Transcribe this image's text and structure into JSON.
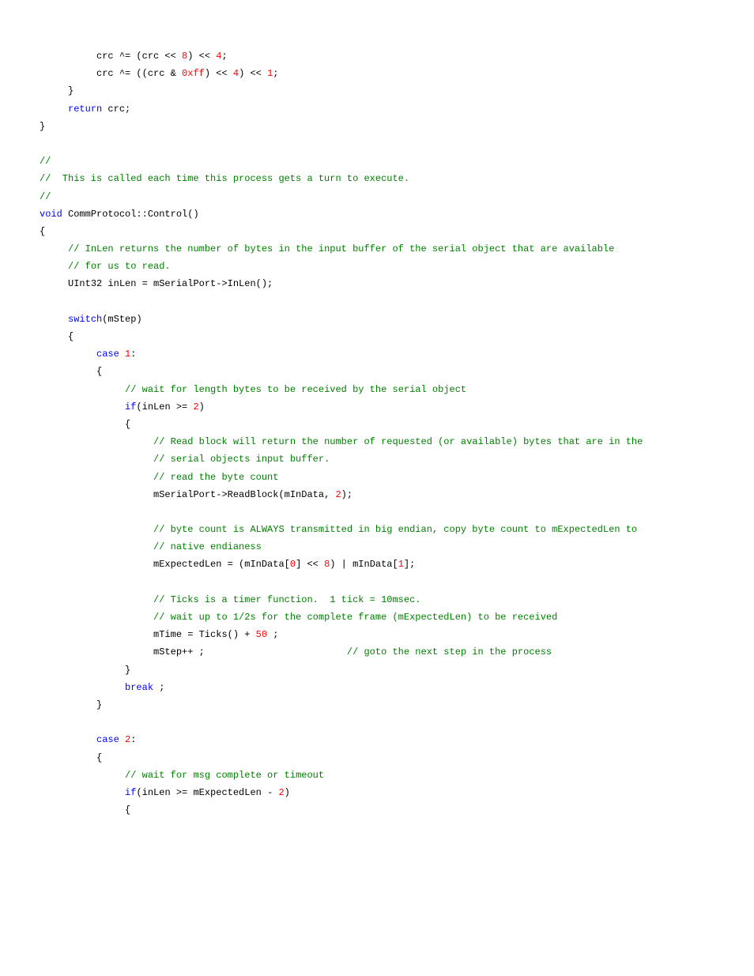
{
  "lines": [
    [
      {
        "t": "          crc ^= (crc << ",
        "c": ""
      },
      {
        "t": "8",
        "c": "num"
      },
      {
        "t": ") << ",
        "c": ""
      },
      {
        "t": "4",
        "c": "num"
      },
      {
        "t": ";",
        "c": ""
      }
    ],
    [
      {
        "t": "          crc ^= ((crc & ",
        "c": ""
      },
      {
        "t": "0xff",
        "c": "hex"
      },
      {
        "t": ") << ",
        "c": ""
      },
      {
        "t": "4",
        "c": "num"
      },
      {
        "t": ") << ",
        "c": ""
      },
      {
        "t": "1",
        "c": "num"
      },
      {
        "t": ";",
        "c": ""
      }
    ],
    [
      {
        "t": "     }",
        "c": ""
      }
    ],
    [
      {
        "t": "     ",
        "c": ""
      },
      {
        "t": "return",
        "c": "kw"
      },
      {
        "t": " crc;",
        "c": ""
      }
    ],
    [
      {
        "t": "}",
        "c": ""
      }
    ],
    [
      {
        "t": "",
        "c": ""
      }
    ],
    [
      {
        "t": "//",
        "c": "comment"
      }
    ],
    [
      {
        "t": "//  This is called each time this process gets a turn to execute.",
        "c": "comment"
      }
    ],
    [
      {
        "t": "//",
        "c": "comment"
      }
    ],
    [
      {
        "t": "void",
        "c": "kw"
      },
      {
        "t": " CommProtocol::Control()",
        "c": ""
      }
    ],
    [
      {
        "t": "{",
        "c": ""
      }
    ],
    [
      {
        "t": "     ",
        "c": ""
      },
      {
        "t": "// InLen returns the number of bytes in the input buffer of the serial object that are available",
        "c": "comment"
      }
    ],
    [
      {
        "t": "     ",
        "c": ""
      },
      {
        "t": "// for us to read.",
        "c": "comment"
      }
    ],
    [
      {
        "t": "     UInt32 inLen = mSerialPort->InLen();",
        "c": ""
      }
    ],
    [
      {
        "t": "",
        "c": ""
      }
    ],
    [
      {
        "t": "     ",
        "c": ""
      },
      {
        "t": "switch",
        "c": "kw"
      },
      {
        "t": "(mStep)",
        "c": ""
      }
    ],
    [
      {
        "t": "     {",
        "c": ""
      }
    ],
    [
      {
        "t": "          ",
        "c": ""
      },
      {
        "t": "case",
        "c": "kw"
      },
      {
        "t": " ",
        "c": ""
      },
      {
        "t": "1",
        "c": "num"
      },
      {
        "t": ":",
        "c": ""
      }
    ],
    [
      {
        "t": "          {",
        "c": ""
      }
    ],
    [
      {
        "t": "               ",
        "c": ""
      },
      {
        "t": "// wait for length bytes to be received by the serial object",
        "c": "comment"
      }
    ],
    [
      {
        "t": "               ",
        "c": ""
      },
      {
        "t": "if",
        "c": "kw"
      },
      {
        "t": "(inLen >= ",
        "c": ""
      },
      {
        "t": "2",
        "c": "num"
      },
      {
        "t": ")",
        "c": ""
      }
    ],
    [
      {
        "t": "               {",
        "c": ""
      }
    ],
    [
      {
        "t": "                    ",
        "c": ""
      },
      {
        "t": "// Read block will return the number of requested (or available) bytes that are in the",
        "c": "comment"
      }
    ],
    [
      {
        "t": "                    ",
        "c": ""
      },
      {
        "t": "// serial objects input buffer.",
        "c": "comment"
      }
    ],
    [
      {
        "t": "                    ",
        "c": ""
      },
      {
        "t": "// read the byte count",
        "c": "comment"
      }
    ],
    [
      {
        "t": "                    mSerialPort->ReadBlock(mInData, ",
        "c": ""
      },
      {
        "t": "2",
        "c": "num"
      },
      {
        "t": ");",
        "c": ""
      }
    ],
    [
      {
        "t": "",
        "c": ""
      }
    ],
    [
      {
        "t": "                    ",
        "c": ""
      },
      {
        "t": "// byte count is ALWAYS transmitted in big endian, copy byte count to mExpectedLen to",
        "c": "comment"
      }
    ],
    [
      {
        "t": "                    ",
        "c": ""
      },
      {
        "t": "// native endianess",
        "c": "comment"
      }
    ],
    [
      {
        "t": "                    mExpectedLen = (mInData[",
        "c": ""
      },
      {
        "t": "0",
        "c": "num"
      },
      {
        "t": "] << ",
        "c": ""
      },
      {
        "t": "8",
        "c": "num"
      },
      {
        "t": ") | mInData[",
        "c": ""
      },
      {
        "t": "1",
        "c": "num"
      },
      {
        "t": "];",
        "c": ""
      }
    ],
    [
      {
        "t": "",
        "c": ""
      }
    ],
    [
      {
        "t": "                    ",
        "c": ""
      },
      {
        "t": "// Ticks is a timer function.  1 tick = 10msec.",
        "c": "comment"
      }
    ],
    [
      {
        "t": "                    ",
        "c": ""
      },
      {
        "t": "// wait up to 1/2s for the complete frame (mExpectedLen) to be received",
        "c": "comment"
      }
    ],
    [
      {
        "t": "                    mTime = Ticks() + ",
        "c": ""
      },
      {
        "t": "50",
        "c": "num"
      },
      {
        "t": " ;",
        "c": ""
      }
    ],
    [
      {
        "t": "                    mStep++ ;                         ",
        "c": ""
      },
      {
        "t": "// goto the next step in the process",
        "c": "comment"
      }
    ],
    [
      {
        "t": "               }",
        "c": ""
      }
    ],
    [
      {
        "t": "               ",
        "c": ""
      },
      {
        "t": "break",
        "c": "kw"
      },
      {
        "t": " ;",
        "c": ""
      }
    ],
    [
      {
        "t": "          }",
        "c": ""
      }
    ],
    [
      {
        "t": "",
        "c": ""
      }
    ],
    [
      {
        "t": "          ",
        "c": ""
      },
      {
        "t": "case",
        "c": "kw"
      },
      {
        "t": " ",
        "c": ""
      },
      {
        "t": "2",
        "c": "num"
      },
      {
        "t": ":",
        "c": ""
      }
    ],
    [
      {
        "t": "          {",
        "c": ""
      }
    ],
    [
      {
        "t": "               ",
        "c": ""
      },
      {
        "t": "// wait for msg complete or timeout",
        "c": "comment"
      }
    ],
    [
      {
        "t": "               ",
        "c": ""
      },
      {
        "t": "if",
        "c": "kw"
      },
      {
        "t": "(inLen >= mExpectedLen - ",
        "c": ""
      },
      {
        "t": "2",
        "c": "num"
      },
      {
        "t": ")",
        "c": ""
      }
    ],
    [
      {
        "t": "               {",
        "c": ""
      }
    ]
  ]
}
